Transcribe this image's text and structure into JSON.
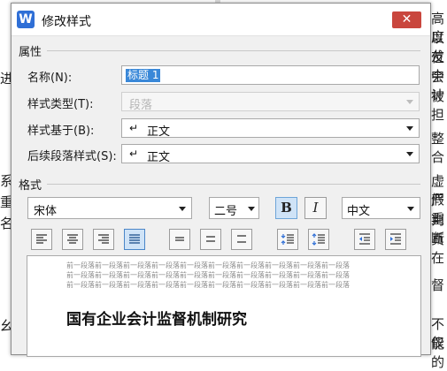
{
  "background": {
    "left_fragments": [
      "进",
      "系",
      "重",
      "名",
      "幺"
    ],
    "right_fragments": [
      "高度",
      "以犮",
      "位中",
      "会计",
      "被担",
      "整合",
      "虚假",
      "严重",
      "判断",
      "真在",
      "督",
      "不仅",
      "能的"
    ]
  },
  "dialog": {
    "app_icon": "W",
    "title": "修改样式",
    "close_symbol": "✕"
  },
  "properties": {
    "section_title": "属性",
    "name_label": "名称(N):",
    "name_value": "标题 1",
    "style_type_label": "样式类型(T):",
    "style_type_value": "段落",
    "based_on_label": "样式基于(B):",
    "based_on_value": "正文",
    "following_label": "后续段落样式(S):",
    "following_value": "正文",
    "para_mark_symbol": "↵"
  },
  "format": {
    "section_title": "格式",
    "font": "宋体",
    "size": "二号",
    "bold_label": "B",
    "italic_label": "I",
    "language": "中文",
    "align_buttons": [
      "align-left",
      "align-center",
      "align-right",
      "align-justify"
    ],
    "spacing_buttons": [
      "single-spacing",
      "1.5-spacing",
      "double-spacing"
    ],
    "para_spacing_buttons": [
      "decrease-paragraph-spacing",
      "increase-paragraph-spacing"
    ],
    "indent_buttons": [
      "decrease-indent",
      "increase-indent"
    ],
    "active_align": "align-justify"
  },
  "preview": {
    "prev_lines": [
      "前一段落前一段落前一段落前一段落前一段落前一段落前一段落前一段落前一段落前一段落",
      "前一段落前一段落前一段落前一段落前一段落前一段落前一段落前一段落前一段落前一段落",
      "前一段落前一段落前一段落前一段落前一段落前一段落前一段落前一段落前一段落前一段落"
    ],
    "sample_text": "国有企业会计监督机制研究"
  },
  "colors": {
    "accent_blue": "#3a88d8",
    "close_red": "#c9463d",
    "dialog_bg": "#f0f0f0"
  }
}
